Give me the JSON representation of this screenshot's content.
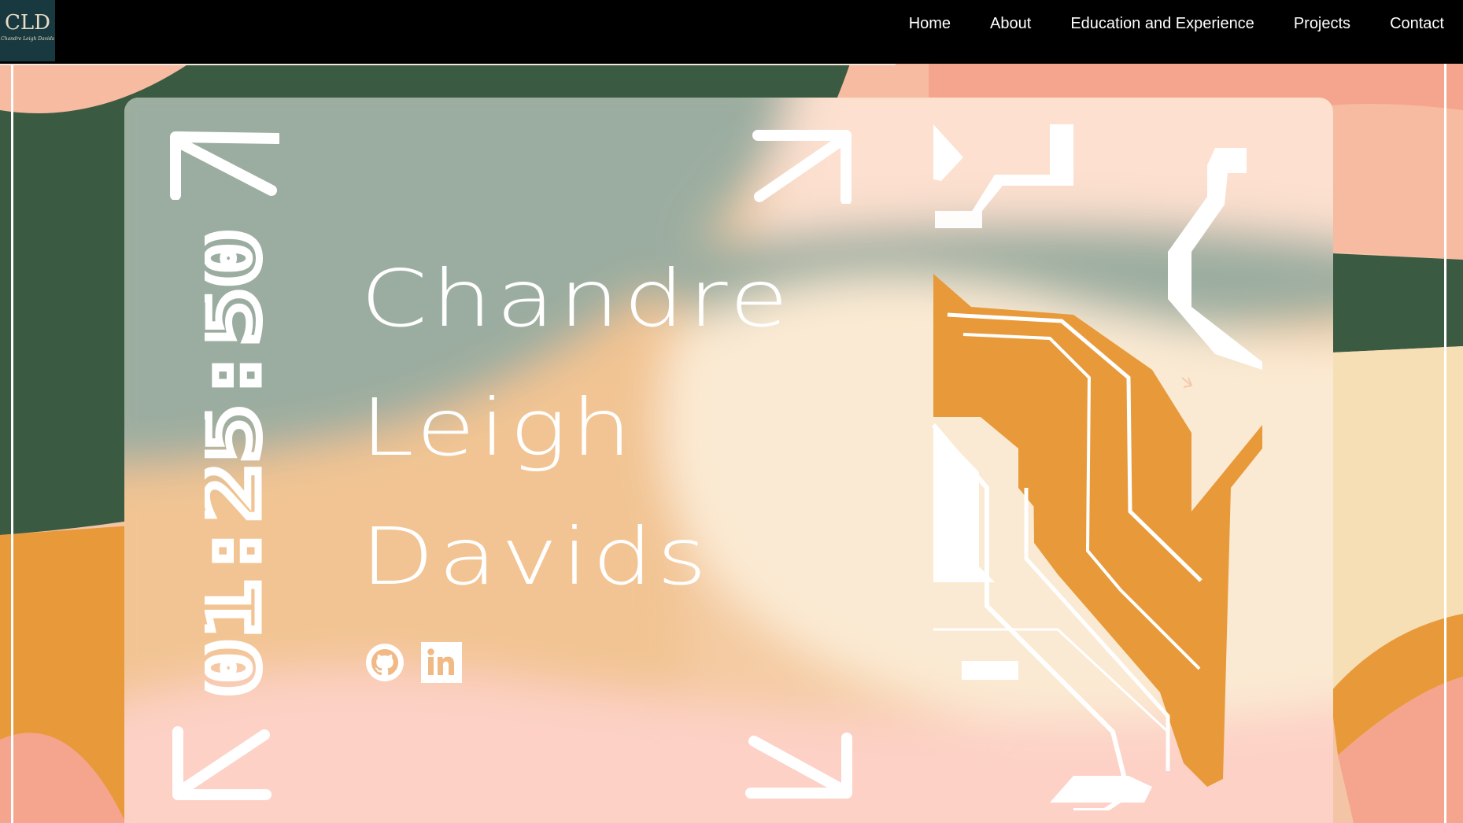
{
  "logo": {
    "initials": "CLD",
    "subtitle": "Chandre Leigh Davids"
  },
  "nav": {
    "items": [
      {
        "label": "Home"
      },
      {
        "label": "About"
      },
      {
        "label": "Education and Experience"
      },
      {
        "label": "Projects"
      },
      {
        "label": "Contact"
      }
    ]
  },
  "hero": {
    "name_lines": [
      "Chandre",
      "Leigh",
      "Davids"
    ],
    "clock_time": "01:25:50"
  },
  "socials": [
    {
      "icon": "github-icon"
    },
    {
      "icon": "linkedin-icon"
    }
  ],
  "colors": {
    "nav_bg": "#000000",
    "logo_bg": "#17393f",
    "dark_green": "#3b5a42",
    "orange": "#e89a3a",
    "peach": "#f6c3a4",
    "salmon": "#f5a58e",
    "sage": "#9bada0",
    "cream": "#fbe9d4",
    "white": "#ffffff"
  }
}
